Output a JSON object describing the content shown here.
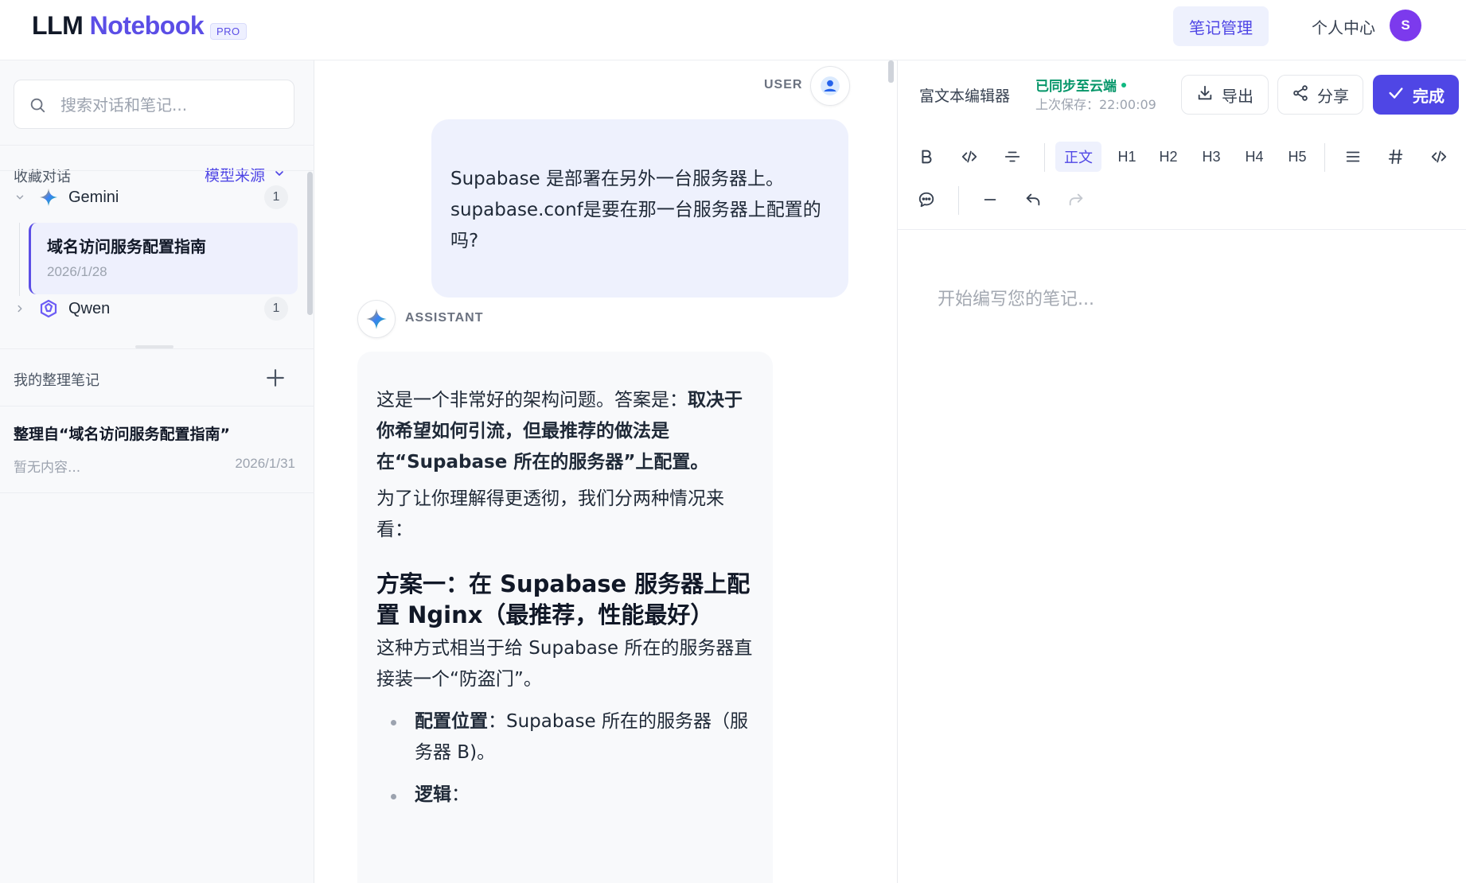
{
  "app": {
    "logo_prefix": "LLM",
    "logo_accent": "Notebook",
    "badge": "PRO",
    "nav_notes": "笔记管理",
    "nav_profile": "个人中心",
    "avatar_initial": "S",
    "accent_color": "#4f46e5"
  },
  "sidebar": {
    "search_placeholder": "搜索对话和笔记...",
    "favorites_title": "收藏对话",
    "model_source_label": "模型来源",
    "groups": [
      {
        "name": "Gemini",
        "count": "1",
        "expanded": true,
        "icon": "gemini-icon"
      },
      {
        "name": "Qwen",
        "count": "1",
        "expanded": false,
        "icon": "qwen-icon"
      }
    ],
    "selected_conversation": {
      "title": "域名访问服务配置指南",
      "date": "2026/1/28"
    },
    "notes_title": "我的整理笔记",
    "notes": [
      {
        "title": "整理自“域名访问服务配置指南”",
        "preview": "暂无内容...",
        "date": "2026/1/31"
      }
    ]
  },
  "chat": {
    "user_role": "USER",
    "assistant_role": "ASSISTANT",
    "user_message": "Supabase 是部署在另外一台服务器上。supabase.conf是要在那一台服务器上配置的吗?",
    "assistant": {
      "intro_plain": "这是一个非常好的架构问题。答案是：",
      "intro_bold": "取决于你希望如何引流，但最推荐的做法是在“Supabase 所在的服务器”上配置。",
      "para2": "为了让你理解得更透彻，我们分两种情况来看：",
      "heading1": "方案一：在 Supabase 服务器上配置 Nginx（最推荐，性能最好）",
      "para3": "这种方式相当于给 Supabase 所在的服务器直接装一个“防盗门”。",
      "bullet1_bold": "配置位置",
      "bullet1_text": "：Supabase 所在的服务器（服务器 B)。",
      "bullet2_bold": "逻辑",
      "bullet2_text": "："
    }
  },
  "editor": {
    "title": "富文本编辑器",
    "sync_status": "已同步至云端",
    "last_saved": "上次保存：22:00:09",
    "export_label": "导出",
    "share_label": "分享",
    "done_label": "完成",
    "toolbar": {
      "paragraph": "正文",
      "h1": "H1",
      "h2": "H2",
      "h3": "H3",
      "h4": "H4",
      "h5": "H5"
    },
    "placeholder": "开始编写您的笔记..."
  }
}
